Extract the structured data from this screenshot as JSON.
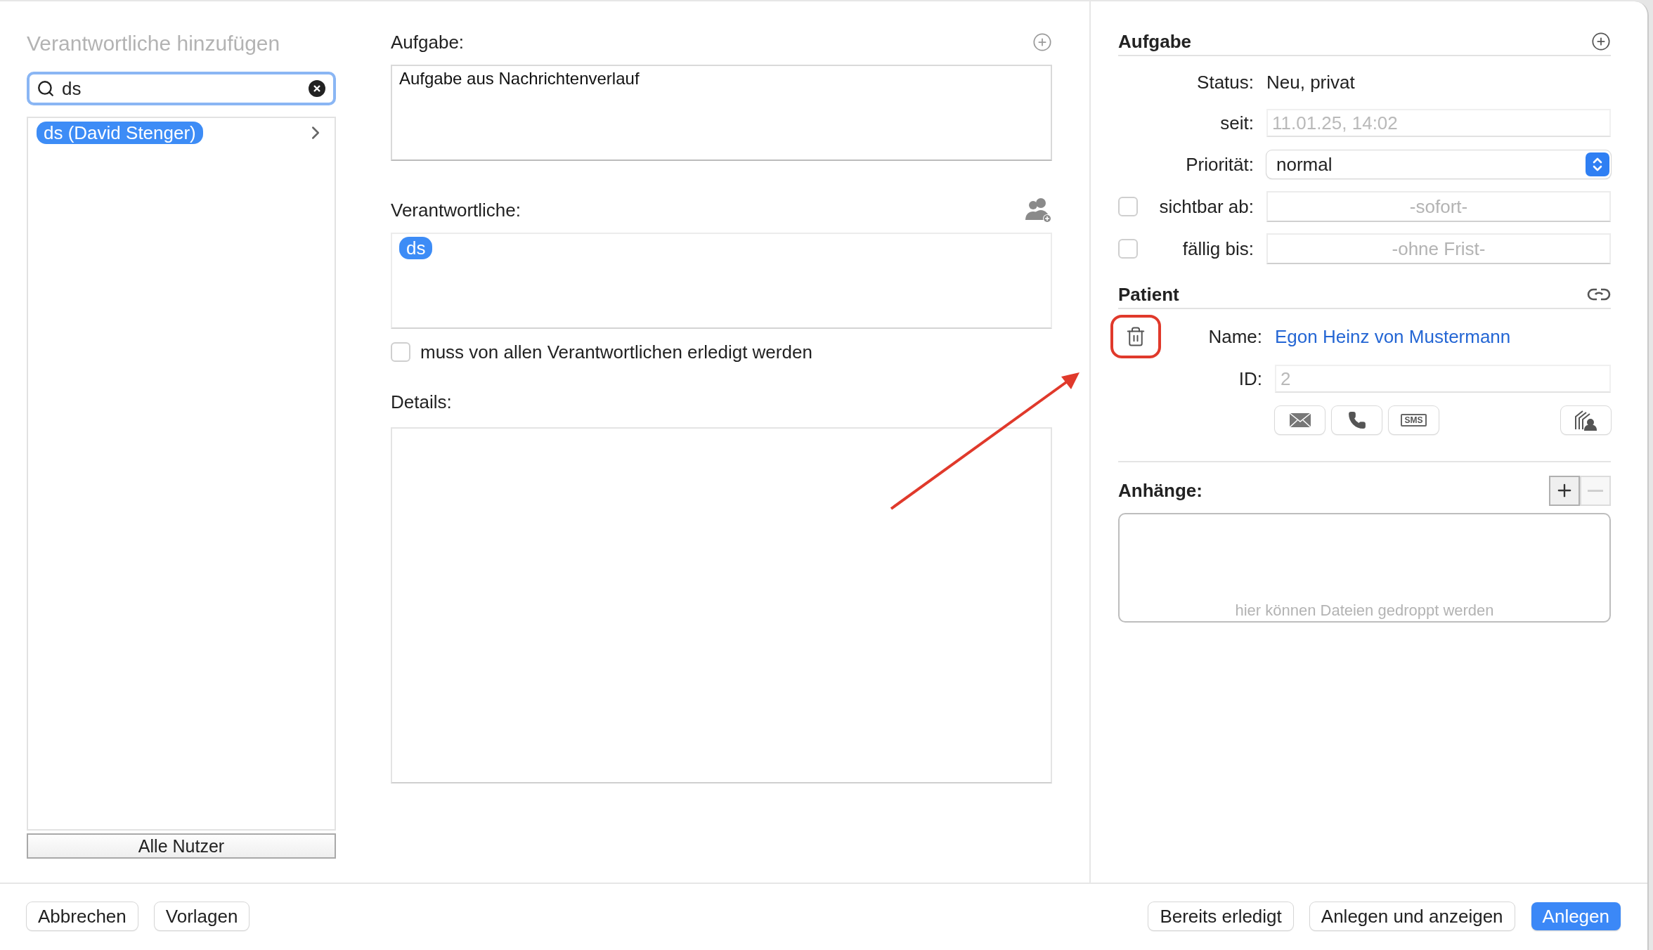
{
  "sidebar": {
    "title": "Verantwortliche hinzufügen",
    "search": {
      "value": "ds"
    },
    "results": [
      {
        "label": "ds (David Stenger)",
        "selected": true
      }
    ],
    "all_users_button": "Alle Nutzer"
  },
  "task": {
    "label": "Aufgabe:",
    "text": "Aufgabe aus Nachrichtenverlauf"
  },
  "assignees": {
    "label": "Verantwortliche:",
    "tokens": [
      "ds"
    ],
    "all_must_complete": {
      "label": "muss von allen Verantwortlichen erledigt werden",
      "checked": false
    }
  },
  "details": {
    "label": "Details:"
  },
  "info": {
    "title": "Aufgabe",
    "status_label": "Status:",
    "status": "Neu, privat",
    "since_label": "seit:",
    "since": "11.01.25, 14:02",
    "priority_label": "Priorität:",
    "priority": "normal",
    "visible_from": {
      "label": "sichtbar ab:",
      "placeholder": "-sofort-",
      "checked": false
    },
    "due": {
      "label": "fällig bis:",
      "placeholder": "-ohne Frist-",
      "checked": false
    }
  },
  "patient": {
    "title": "Patient",
    "name_label": "Name:",
    "name": "Egon Heinz von Mustermann",
    "id_label": "ID:",
    "id": "2",
    "delete_highlighted": true,
    "sms_label": "SMS"
  },
  "attachments": {
    "title": "Anhänge:",
    "hint": "hier können Dateien gedroppt werden",
    "remove_disabled": true
  },
  "annotation_arrow": true,
  "footer": {
    "left": [
      "Abbrechen",
      "Vorlagen"
    ],
    "right": [
      {
        "label": "Bereits erledigt",
        "kind": "default"
      },
      {
        "label": "Anlegen und anzeigen",
        "kind": "default"
      },
      {
        "label": "Anlegen",
        "kind": "primary"
      }
    ]
  }
}
